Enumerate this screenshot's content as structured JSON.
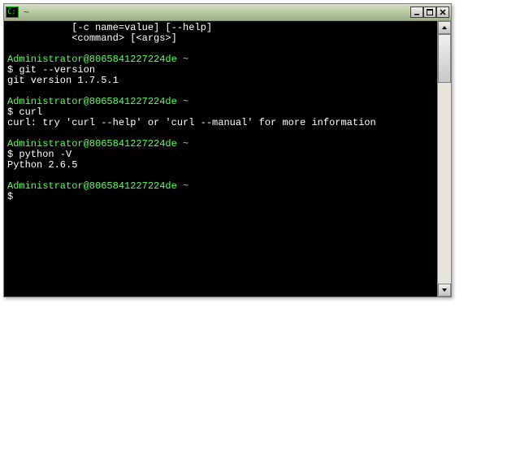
{
  "window": {
    "title": "~",
    "icon_glyph": "C:"
  },
  "terminal": {
    "lines": [
      {
        "type": "out",
        "text": "           [-c name=value] [--help]"
      },
      {
        "type": "out",
        "text": "           <command> [<args>]"
      },
      {
        "type": "blank",
        "text": ""
      },
      {
        "type": "prompt",
        "user": "Administrator@8065841227224de",
        "path": "~"
      },
      {
        "type": "cmd",
        "text": "git --version"
      },
      {
        "type": "out",
        "text": "git version 1.7.5.1"
      },
      {
        "type": "blank",
        "text": ""
      },
      {
        "type": "prompt",
        "user": "Administrator@8065841227224de",
        "path": "~"
      },
      {
        "type": "cmd",
        "text": "curl"
      },
      {
        "type": "out",
        "text": "curl: try 'curl --help' or 'curl --manual' for more information"
      },
      {
        "type": "blank",
        "text": ""
      },
      {
        "type": "prompt",
        "user": "Administrator@8065841227224de",
        "path": "~"
      },
      {
        "type": "cmd",
        "text": "python -V"
      },
      {
        "type": "out",
        "text": "Python 2.6.5"
      },
      {
        "type": "blank",
        "text": ""
      },
      {
        "type": "prompt",
        "user": "Administrator@8065841227224de",
        "path": "~"
      },
      {
        "type": "cmd",
        "text": ""
      }
    ],
    "dollar": "$"
  },
  "colors": {
    "prompt_green": "#55ff55",
    "text_white": "#ffffff",
    "bg_black": "#000000"
  }
}
